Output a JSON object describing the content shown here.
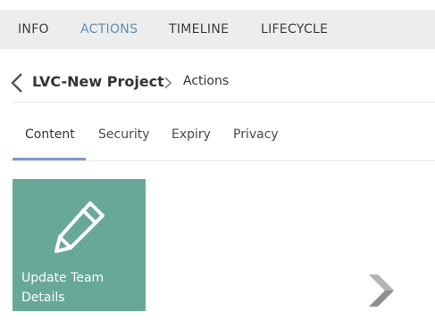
{
  "top_tabs": [
    {
      "label": "INFO"
    },
    {
      "label": "ACTIONS"
    },
    {
      "label": "TIMELINE"
    },
    {
      "label": "LIFECYCLE"
    }
  ],
  "active_top_tab": "ACTIONS",
  "breadcrumb": {
    "parent": "LVC-New Project",
    "current": "Actions"
  },
  "sub_tabs": [
    {
      "label": "Content"
    },
    {
      "label": "Security"
    },
    {
      "label": "Expiry"
    },
    {
      "label": "Privacy"
    }
  ],
  "active_sub_tab": "Content",
  "action_tiles": [
    {
      "label": "Update Team Details",
      "icon": "pencil-icon",
      "color": "#68a898"
    }
  ],
  "colors": {
    "accent": "#5b8fb4",
    "tab_underline": "#7b9bc9",
    "topbar_bg": "#ededed",
    "tile_bg": "#68a898"
  }
}
